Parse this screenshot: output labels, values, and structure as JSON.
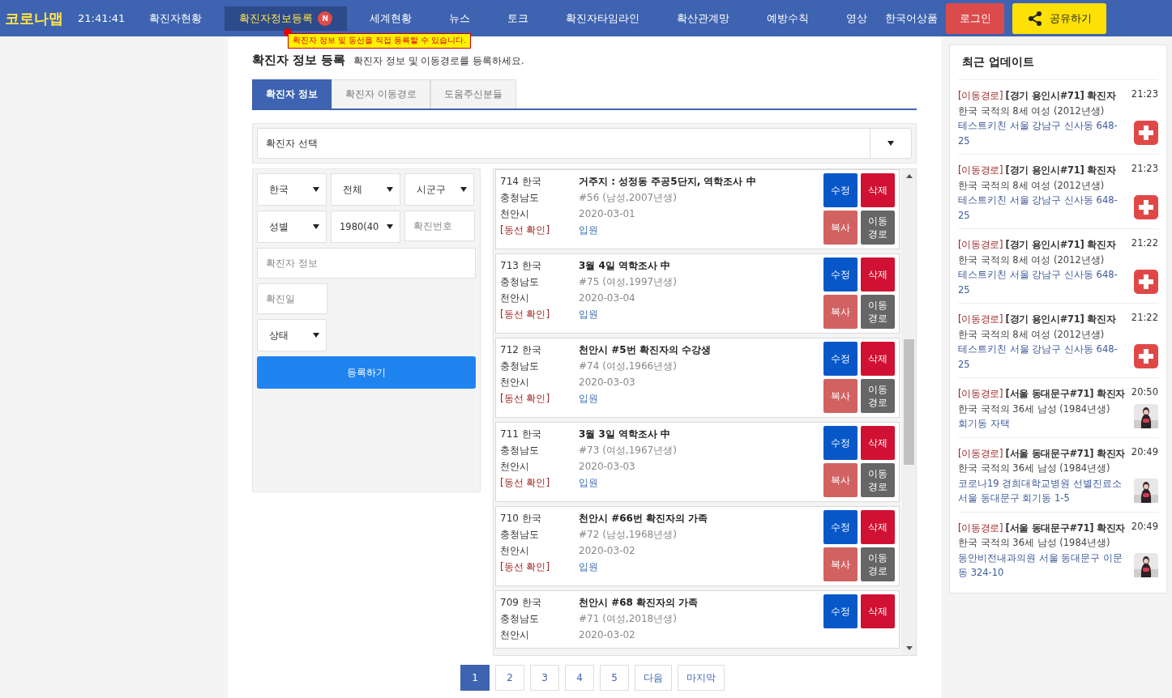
{
  "header": {
    "logo": "코로나맵",
    "time": "21:41:41",
    "nav": [
      {
        "label": "확진자현황",
        "selected": false
      },
      {
        "label": "확진자정보등록",
        "selected": true,
        "badge": "N"
      },
      {
        "label": "세계현황",
        "selected": false
      },
      {
        "label": "뉴스",
        "selected": false
      },
      {
        "label": "토크",
        "selected": false
      },
      {
        "label": "확진자타임라인",
        "selected": false
      },
      {
        "label": "확산관계망",
        "selected": false
      },
      {
        "label": "예방수칙",
        "selected": false
      },
      {
        "label": "영상",
        "selected": false
      }
    ],
    "language": "한국어상품",
    "login": "로그인",
    "share": "공유하기",
    "tooltip": "확진자 정보 및 동선을 직접 등록할 수 있습니다."
  },
  "page": {
    "title": "확진자 정보 등록",
    "subtitle": "확진자 정보 및 이동경로를 등록하세요.",
    "tabs": [
      {
        "label": "확진자 정보",
        "selected": true
      },
      {
        "label": "확진자 이동경로",
        "selected": false
      },
      {
        "label": "도움주신분들",
        "selected": false
      }
    ],
    "patient_select": "확진자 선택"
  },
  "form": {
    "country": "한국",
    "province": "전체",
    "district": "시군구",
    "gender": "성별",
    "birth_year": "1980(40",
    "number_placeholder": "확진번호",
    "info_placeholder": "확진자 정보",
    "date_placeholder": "확진일",
    "status": "상태",
    "submit": "등록하기"
  },
  "cases": [
    {
      "head": "714 한국",
      "province": "충청남도",
      "city": "천안시",
      "route_link": "[동선 확인]",
      "title": "거주지 : 성정동 주공5단지, 역학조사 中",
      "info": "#56 (남성,2007년생)",
      "date": "2020-03-01",
      "status": "입원",
      "buttons": [
        {
          "label": "수정",
          "kind": "edit"
        },
        {
          "label": "복사",
          "kind": "copy"
        },
        {
          "label": "삭제",
          "kind": "delete"
        },
        {
          "label": "이동경로",
          "kind": "route"
        }
      ]
    },
    {
      "head": "713 한국",
      "province": "충청남도",
      "city": "천안시",
      "route_link": "[동선 확인]",
      "title": "3월 4일 역학조사 中",
      "info": "#75 (여성,1997년생)",
      "date": "2020-03-04",
      "status": "입원",
      "buttons": [
        {
          "label": "수정",
          "kind": "edit"
        },
        {
          "label": "복사",
          "kind": "copy"
        },
        {
          "label": "삭제",
          "kind": "delete"
        },
        {
          "label": "이동경로",
          "kind": "route"
        }
      ]
    },
    {
      "head": "712 한국",
      "province": "충청남도",
      "city": "천안시",
      "route_link": "[동선 확인]",
      "title": "천안시 #5번 확진자의 수강생",
      "info": "#74 (여성,1966년생)",
      "date": "2020-03-03",
      "status": "입원",
      "buttons": [
        {
          "label": "수정",
          "kind": "edit"
        },
        {
          "label": "복사",
          "kind": "copy"
        },
        {
          "label": "삭제",
          "kind": "delete"
        },
        {
          "label": "이동경로",
          "kind": "route"
        }
      ]
    },
    {
      "head": "711 한국",
      "province": "충청남도",
      "city": "천안시",
      "route_link": "[동선 확인]",
      "title": "3월 3일 역학조사 中",
      "info": "#73 (여성,1967년생)",
      "date": "2020-03-03",
      "status": "입원",
      "buttons": [
        {
          "label": "수정",
          "kind": "edit"
        },
        {
          "label": "복사",
          "kind": "copy"
        },
        {
          "label": "삭제",
          "kind": "delete"
        },
        {
          "label": "이동경로",
          "kind": "route"
        }
      ]
    },
    {
      "head": "710 한국",
      "province": "충청남도",
      "city": "천안시",
      "route_link": "[동선 확인]",
      "title": "천안시 #66번 확진자의 가족",
      "info": "#72 (남성,1968년생)",
      "date": "2020-03-02",
      "status": "입원",
      "buttons": [
        {
          "label": "수정",
          "kind": "edit"
        },
        {
          "label": "복사",
          "kind": "copy"
        },
        {
          "label": "삭제",
          "kind": "delete"
        },
        {
          "label": "이동경로",
          "kind": "route"
        }
      ]
    },
    {
      "head": "709 한국",
      "province": "충청남도",
      "city": "천안시",
      "title": "천안시 #68 확진자의 가족",
      "info": "#71 (여성,2018년생)",
      "date": "2020-03-02",
      "buttons": [
        {
          "label": "수정",
          "kind": "edit"
        },
        {
          "label": "삭제",
          "kind": "delete"
        }
      ]
    }
  ],
  "pagination": [
    {
      "label": "1",
      "selected": true
    },
    {
      "label": "2",
      "selected": false
    },
    {
      "label": "3",
      "selected": false
    },
    {
      "label": "4",
      "selected": false
    },
    {
      "label": "5",
      "selected": false
    },
    {
      "label": "다음",
      "selected": false
    },
    {
      "label": "마지막",
      "selected": false
    }
  ],
  "sidebar": {
    "title": "최근 업데이트",
    "updates": [
      {
        "tag": "[이동경로]",
        "title": "[경기 용인시#71] 확진자",
        "time": "21:23",
        "detail": "한국 국적의 8세 여성 (2012년생)",
        "place": "테스트키친 서울 강남구 신사동 648-25",
        "kind": "cross"
      },
      {
        "tag": "[이동경로]",
        "title": "[경기 용인시#71] 확진자",
        "time": "21:23",
        "detail": "한국 국적의 8세 여성 (2012년생)",
        "place": "테스트키친 서울 강남구 신사동 648-25",
        "kind": "cross"
      },
      {
        "tag": "[이동경로]",
        "title": "[경기 용인시#71] 확진자",
        "time": "21:22",
        "detail": "한국 국적의 8세 여성 (2012년생)",
        "place": "테스트키친 서울 강남구 신사동 648-25",
        "kind": "cross"
      },
      {
        "tag": "[이동경로]",
        "title": "[경기 용인시#71] 확진자",
        "time": "21:22",
        "detail": "한국 국적의 8세 여성 (2012년생)",
        "place": "테스트키친 서울 강남구 신사동 648-25",
        "kind": "cross"
      },
      {
        "tag": "[이동경로]",
        "title": "[서울 동대문구#71] 확진자",
        "time": "20:50",
        "detail": "한국 국적의 36세 남성 (1984년생)",
        "place": "회기동 자택",
        "kind": "picture"
      },
      {
        "tag": "[이동경로]",
        "title": "[서울 동대문구#71] 확진자",
        "time": "20:49",
        "detail": "한국 국적의 36세 남성 (1984년생)",
        "place": "코로나19 경희대학교병원 선별진료소 서울 동대문구 회기동 1-5",
        "kind": "picture"
      },
      {
        "tag": "[이동경로]",
        "title": "[서울 동대문구#71] 확진자",
        "time": "20:49",
        "detail": "한국 국적의 36세 남성 (1984년생)",
        "place": "동안비전내과의원 서울 동대문구 이문동 324-10",
        "kind": "picture"
      }
    ]
  }
}
